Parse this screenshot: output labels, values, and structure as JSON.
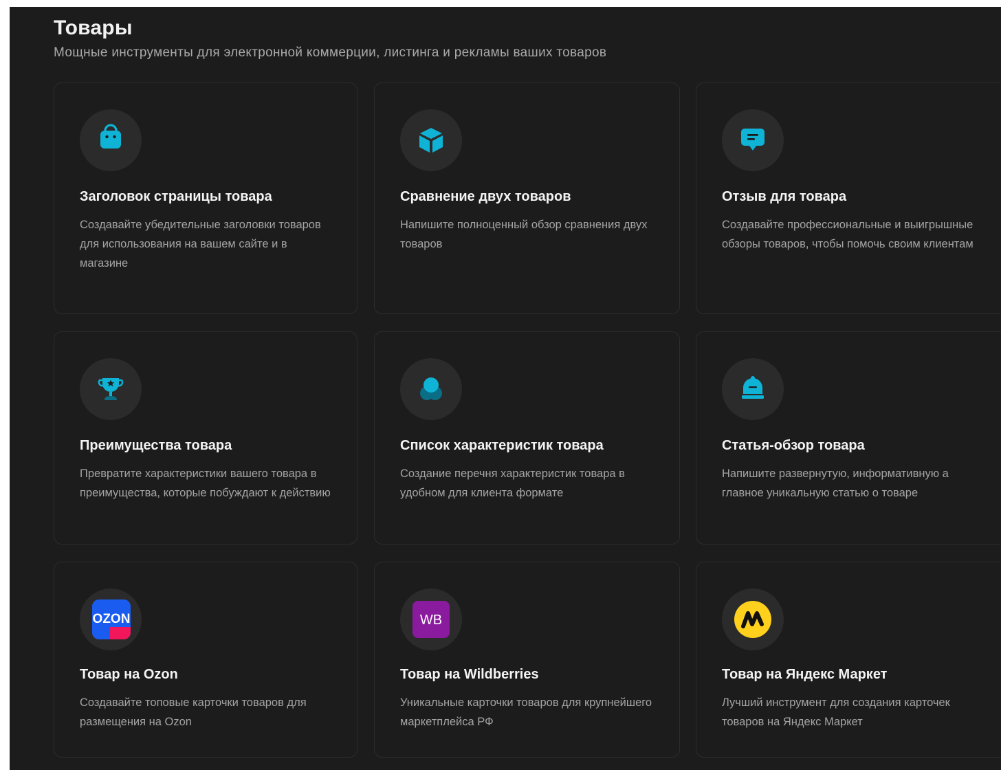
{
  "section": {
    "title": "Товары",
    "subtitle": "Мощные инструменты для электронной коммерции, листинга и рекламы ваших товаров"
  },
  "colors": {
    "background": "#1c1c1c",
    "card_border": "#2c2c2c",
    "icon_circle": "#2b2b2b",
    "accent": "#0fb3d6"
  },
  "cards": [
    {
      "icon": "shopping-bag-icon",
      "title": "Заголовок страницы товара",
      "description": "Создавайте убедительные заголовки товаров для использования на вашем сайте и в магазине"
    },
    {
      "icon": "cube-icon",
      "title": "Сравнение двух товаров",
      "description": "Напишите полноценный обзор сравнения двух товаров"
    },
    {
      "icon": "chat-message-icon",
      "title": "Отзыв для товара",
      "description": "Создавайте профессиональные и выигрышные обзоры товаров, чтобы помочь своим клиентам"
    },
    {
      "icon": "trophy-icon",
      "title": "Преимущества товара",
      "description": "Превратите характеристики вашего товара в преимущества, которые побуждают к действию"
    },
    {
      "icon": "circles-icon",
      "title": "Список характеристик товара",
      "description": "Создание перечня характеристик товара в удобном для клиента формате"
    },
    {
      "icon": "service-bell-icon",
      "title": "Статья-обзор товара",
      "description": "Напишите развернутую, информативную а главное уникальную статью о товаре"
    },
    {
      "icon": "ozon-logo-icon",
      "title": "Товар на Ozon",
      "description": "Создавайте топовые карточки товаров для размещения на Ozon",
      "logo_text": "OZON"
    },
    {
      "icon": "wildberries-logo-icon",
      "title": "Товар на Wildberries",
      "description": "Уникальные карточки товаров для крупнейшего маркетплейса РФ",
      "logo_text": "WB"
    },
    {
      "icon": "yandex-market-logo-icon",
      "title": "Товар на Яндекс Маркет",
      "description": "Лучший инструмент для создания карточек товаров на Яндекс Маркет"
    }
  ]
}
